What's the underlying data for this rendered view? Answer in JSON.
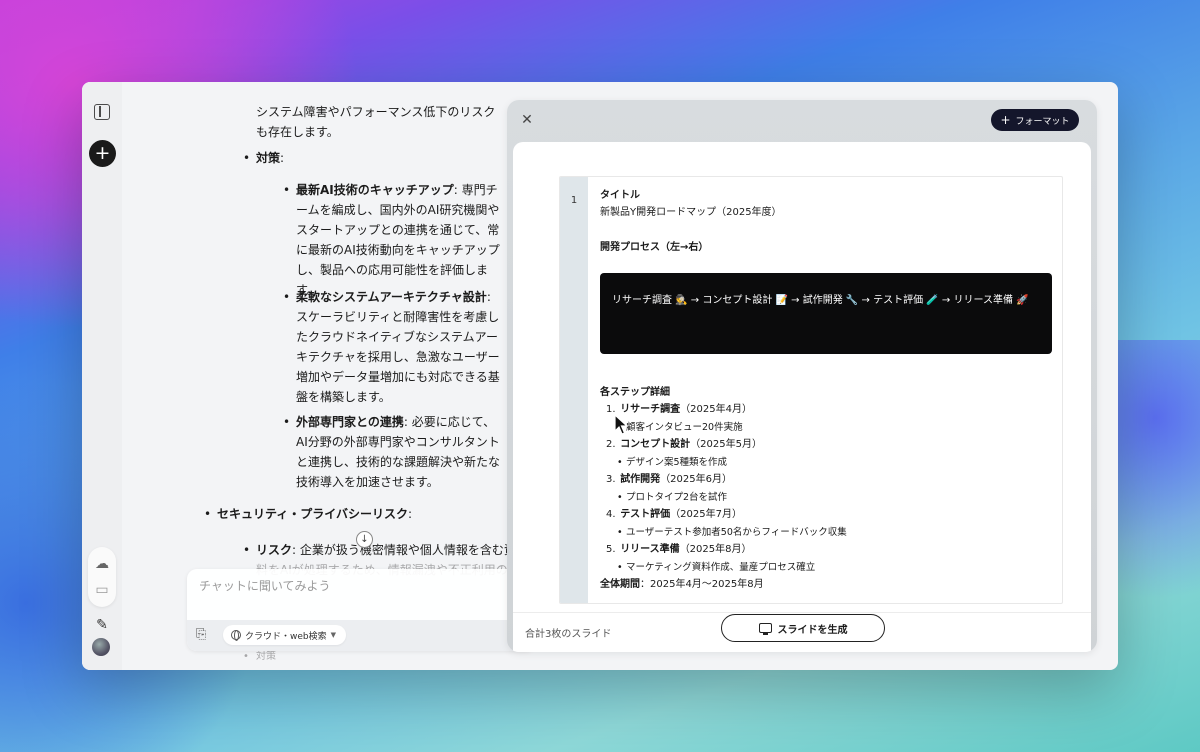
{
  "chat": {
    "messages": [
      "システム障害やパフォーマンス低下のリスクも存在します。",
      "対策",
      "最新AI技術のキャッチアップ",
      ": 専門チームを編成し、国内外のAI研究機関やスタートアップとの連携を通じて、常に最新のAI技術動向をキャッチアップし、製品への応用可能性を評価します。",
      "柔軟なシステムアーキテクチャ設計",
      ": スケーラビリティと耐障害性を考慮したクラウドネイティブなシステムアーキテクチャを採用し、急激なユーザー増加やデータ量増加にも対応できる基盤を構築します。",
      "外部専門家との連携",
      ": 必要に応じて、AI分野の外部専門家やコンサルタントと連携し、技術的な課題解決や新たな技術導入を加速させます。",
      "セキュリティ・プライバシーリスク",
      "リスク",
      ": 企業が扱う機密情報や個人情報を含む資",
      "料をAIが処理するため、情報漏洩や不正利用の",
      "対策"
    ]
  },
  "composer": {
    "placeholder": "チャットに聞いてみよう",
    "search_mode": "クラウド・web検索"
  },
  "panel": {
    "format_label": "フォーマット",
    "slide": {
      "number": "1",
      "title_heading": "タイトル",
      "title": "新製品Y開発ロードマップ（2025年度）",
      "process_heading": "開発プロセス（左→右）",
      "flow": "リサーチ調査 🕵️ → コンセプト設計 📝 → 試作開発 🔧 → テスト評価 🧪 → リリース準備 🚀",
      "details_heading": "各ステップ詳細",
      "steps": [
        {
          "num": "1.",
          "name": "リサーチ調査",
          "period": "（2025年4月）",
          "detail": "顧客インタビュー20件実施"
        },
        {
          "num": "2.",
          "name": "コンセプト設計",
          "period": "（2025年5月）",
          "detail": "デザイン案5種類を作成"
        },
        {
          "num": "3.",
          "name": "試作開発",
          "period": "（2025年6月）",
          "detail": "プロトタイプ2台を試作"
        },
        {
          "num": "4.",
          "name": "テスト評価",
          "period": "（2025年7月）",
          "detail": "ユーザーテスト参加者50名からフィードバック収集"
        },
        {
          "num": "5.",
          "name": "リリース準備",
          "period": "（2025年8月）",
          "detail": "マーケティング資料作成、量産プロセス確立"
        }
      ],
      "total_label": "全体期間",
      "total_value": "：2025年4月〜2025年8月"
    },
    "footer": {
      "slide_count": "合計3枚のスライド",
      "generate_label": "スライドを生成"
    }
  },
  "icons": {
    "sidebar": "sidebar-toggle-icon",
    "new": "plus-icon",
    "cloud": "cloud-icon",
    "chat": "chat-bubble-icon",
    "edit": "pencil-icon",
    "attach": "paperclip-icon",
    "globe": "globe-icon",
    "send": "arrow-up-icon",
    "close": "close-icon",
    "monitor": "monitor-icon",
    "scroll": "arrow-down-icon"
  }
}
